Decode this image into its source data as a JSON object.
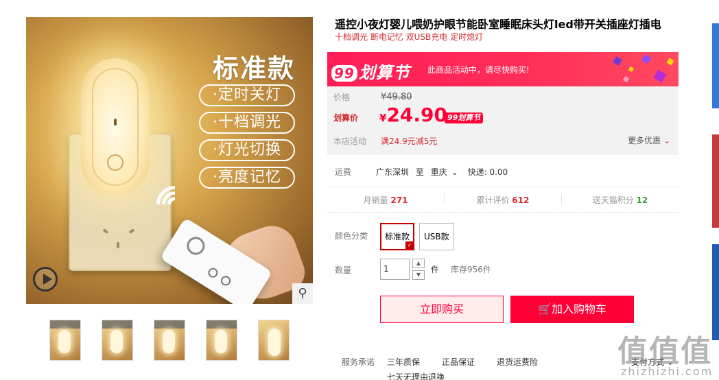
{
  "gallery": {
    "main_image": {
      "title": "标准款",
      "features": [
        "·定时关灯",
        "·十档调光",
        "·灯光切换",
        "·亮度记忆"
      ]
    },
    "zoom_icon": "magnifier-icon",
    "play_icon": "play-icon",
    "thumbnails": [
      "thumb-1",
      "thumb-2",
      "thumb-3",
      "thumb-4",
      "thumb-5"
    ]
  },
  "product": {
    "title": "遥控小夜灯婴儿喂奶护眼节能卧室睡眠床头灯led带开关插座灯插电",
    "subtitle": "十档调光 断电记忆 双USB充电 定时熄灯"
  },
  "banner": {
    "logo_num": "99",
    "logo_text": "划算节",
    "text": "此商品活动中，请尽快购买!",
    "color": "#ff1d55"
  },
  "price": {
    "original_label": "价格",
    "original_value": "¥49.80",
    "current_label": "划算价",
    "currency": "¥",
    "current_value": "24.90",
    "badge": "99划算节",
    "promo_label": "本店活动",
    "promo_text": "满24.9元减5元",
    "more_label": "更多优惠",
    "accent": "#ff0036"
  },
  "shipping": {
    "label": "运费",
    "from": "广东深圳",
    "to_word": "至",
    "to": "重庆",
    "express": "快递: 0.00"
  },
  "stats": {
    "monthly_label": "月销量",
    "monthly_value": "271",
    "reviews_label": "累计评价",
    "reviews_value": "612",
    "points_label": "送天猫积分",
    "points_value": "12"
  },
  "sku": {
    "label": "颜色分类",
    "options": [
      "标准款",
      "USB款"
    ],
    "selected": "标准款"
  },
  "quantity": {
    "label": "数量",
    "value": "1",
    "unit": "件",
    "stock": "库存956件"
  },
  "actions": {
    "buy_now": "立即购买",
    "add_to_cart": "加入购物车"
  },
  "services": {
    "label": "服务承诺",
    "items": [
      "三年质保",
      "正品保证",
      "退货运费险",
      "七天无理由退换"
    ],
    "payment": "支付方式"
  },
  "watermark": {
    "text": "值值值",
    "sub": "zhizhizhi.com"
  }
}
